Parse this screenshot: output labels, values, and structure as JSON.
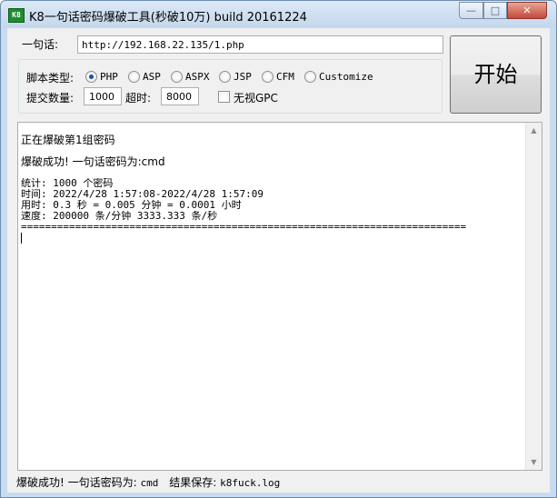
{
  "window": {
    "icon_text": "K8",
    "title": "K8一句话密码爆破工具(秒破10万)  build 20161224",
    "min_glyph": "—",
    "max_glyph": "□",
    "close_glyph": "✕"
  },
  "form": {
    "url_label": "一句话:",
    "url_value": "http://192.168.22.135/1.php",
    "script_type_label": "脚本类型:",
    "script_types": [
      {
        "label": "PHP",
        "checked": true
      },
      {
        "label": "ASP",
        "checked": false
      },
      {
        "label": "ASPX",
        "checked": false
      },
      {
        "label": "JSP",
        "checked": false
      },
      {
        "label": "CFM",
        "checked": false
      },
      {
        "label": "Customize",
        "checked": false
      }
    ],
    "submit_count_label": "提交数量:",
    "submit_count_value": "1000",
    "timeout_label": "超时:",
    "timeout_value": "8000",
    "ignore_gpc_label": "无视GPC",
    "ignore_gpc_checked": false,
    "start_button": "开始"
  },
  "output": {
    "lines": [
      "正在爆破第1组密码",
      "",
      "爆破成功! 一句话密码为:cmd",
      "",
      "统计: 1000 个密码",
      "时间: 2022/4/28 1:57:08-2022/4/28 1:57:09",
      "用时: 0.3 秒 = 0.005 分钟 = 0.0001 小时",
      "速度: 200000 条/分钟 3333.333 条/秒",
      "=========================================================================="
    ]
  },
  "status": {
    "result_label": "爆破成功! 一句话密码为:",
    "password": "cmd",
    "save_label": "结果保存:",
    "save_file": "k8fuck.log"
  }
}
